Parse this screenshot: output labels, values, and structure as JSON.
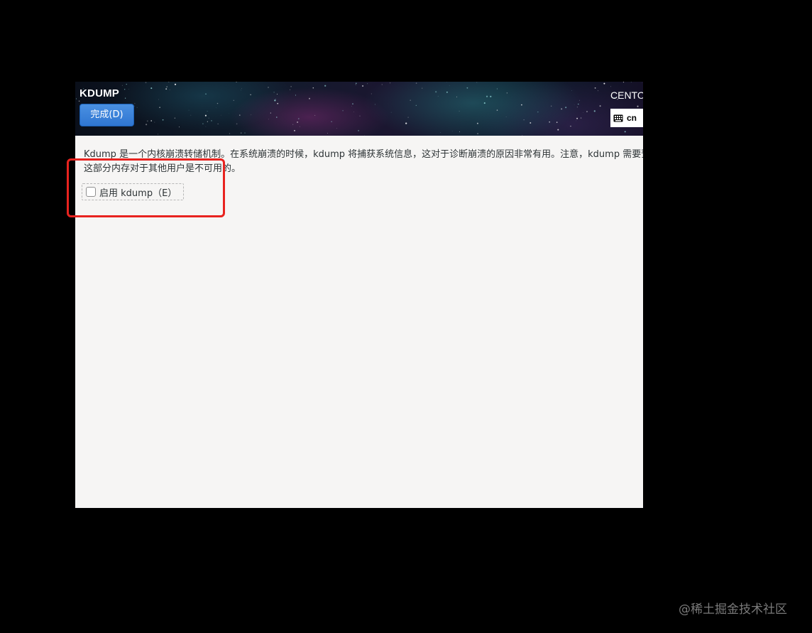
{
  "header": {
    "title": "KDUMP",
    "done_button": "完成(D)",
    "product": "CENTO",
    "keyboard_layout": "cn",
    "keyboard_icon": "keyboard-icon"
  },
  "content": {
    "description_line1": "Kdump 是一个内核崩溃转储机制。在系统崩溃的时候，kdump 将捕获系统信息，这对于诊断崩溃的原因非常有用。注意，kdump 需要预",
    "description_line2": "这部分内存对于其他用户是不可用的。",
    "enable_checkbox_label": "启用 kdump（E）",
    "enable_checkbox_checked": false
  },
  "watermark": "@稀土掘金技术社区",
  "colors": {
    "done_button": "#3584e4",
    "highlight": "#e8231f",
    "window_bg": "#f6f5f4"
  }
}
